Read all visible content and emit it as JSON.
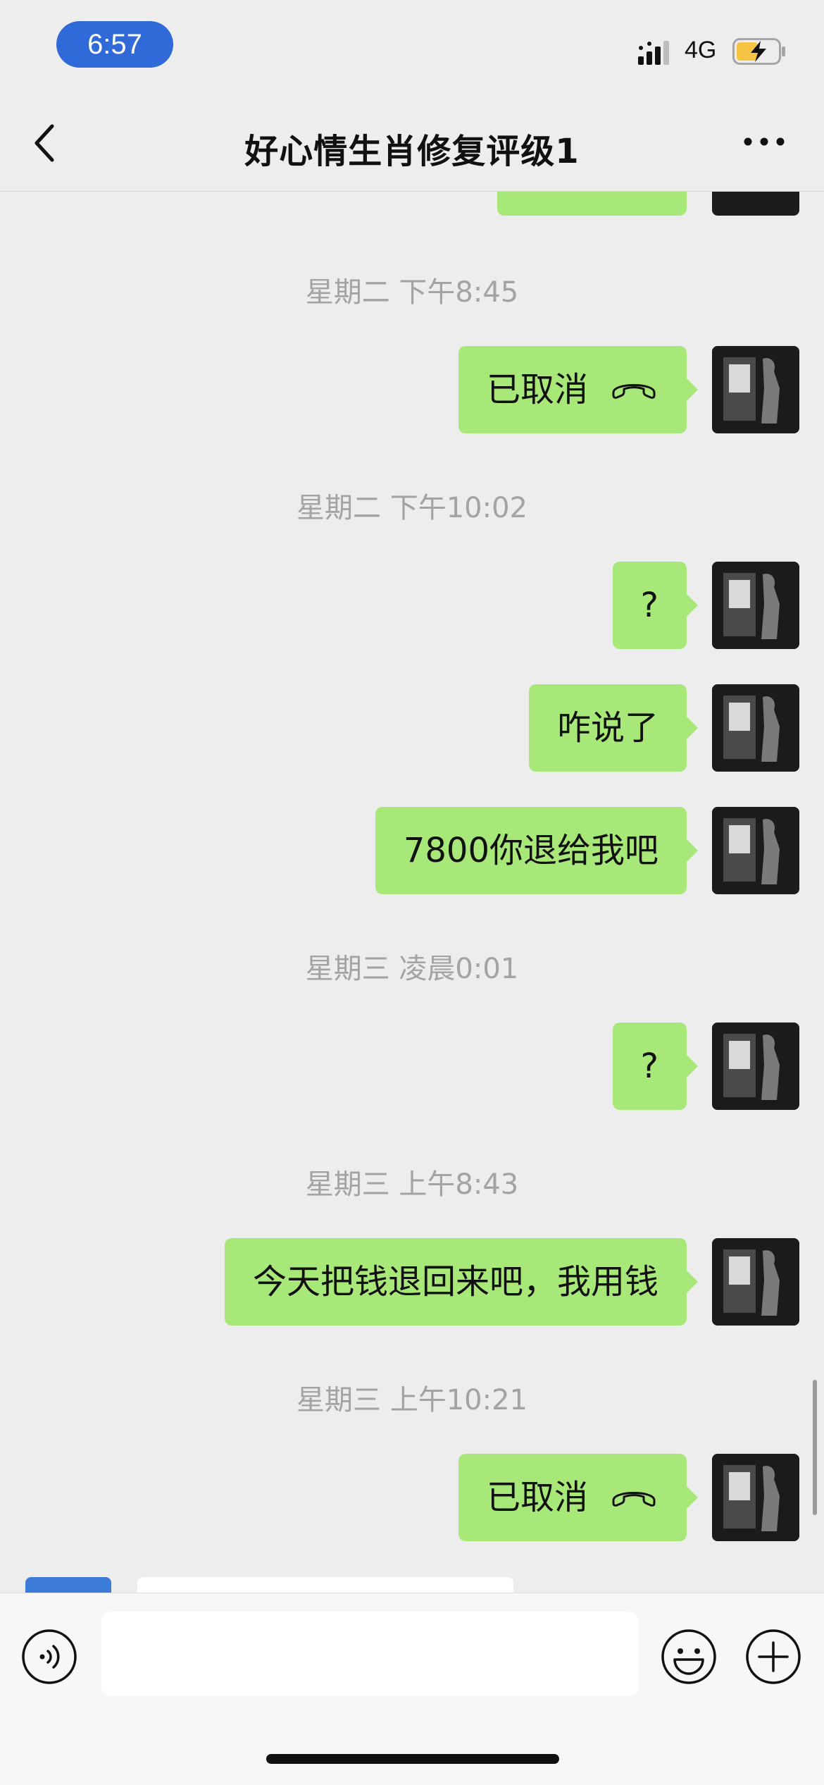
{
  "status_bar": {
    "time": "6:57",
    "network": "4G",
    "battery_color": "#f5c443"
  },
  "header": {
    "title": "好心情生肖修复评级1",
    "back_icon": "chevron-left-icon",
    "more_icon": "ellipsis-icon"
  },
  "colors": {
    "outgoing_bubble": "#a8e879",
    "background": "#ededed",
    "timestamp_text": "#a3a3a3"
  },
  "messages": [
    {
      "type": "timestamp",
      "text": "星期二 下午8:45"
    },
    {
      "type": "call",
      "text": "已取消",
      "icon": "phone-hangup-icon"
    },
    {
      "type": "timestamp",
      "text": "星期二 下午10:02"
    },
    {
      "type": "text",
      "text": "?"
    },
    {
      "type": "text",
      "text": "咋说了"
    },
    {
      "type": "text",
      "text": "7800你退给我吧"
    },
    {
      "type": "timestamp",
      "text": "星期三 凌晨0:01"
    },
    {
      "type": "text",
      "text": "?"
    },
    {
      "type": "timestamp",
      "text": "星期三 上午8:43"
    },
    {
      "type": "text",
      "text": "今天把钱退回来吧，我用钱"
    },
    {
      "type": "timestamp",
      "text": "星期三 上午10:21"
    },
    {
      "type": "call",
      "text": "已取消",
      "icon": "phone-hangup-icon"
    }
  ],
  "input_bar": {
    "voice_icon": "voice-icon",
    "emoji_icon": "emoji-icon",
    "plus_icon": "plus-icon",
    "input_value": ""
  }
}
